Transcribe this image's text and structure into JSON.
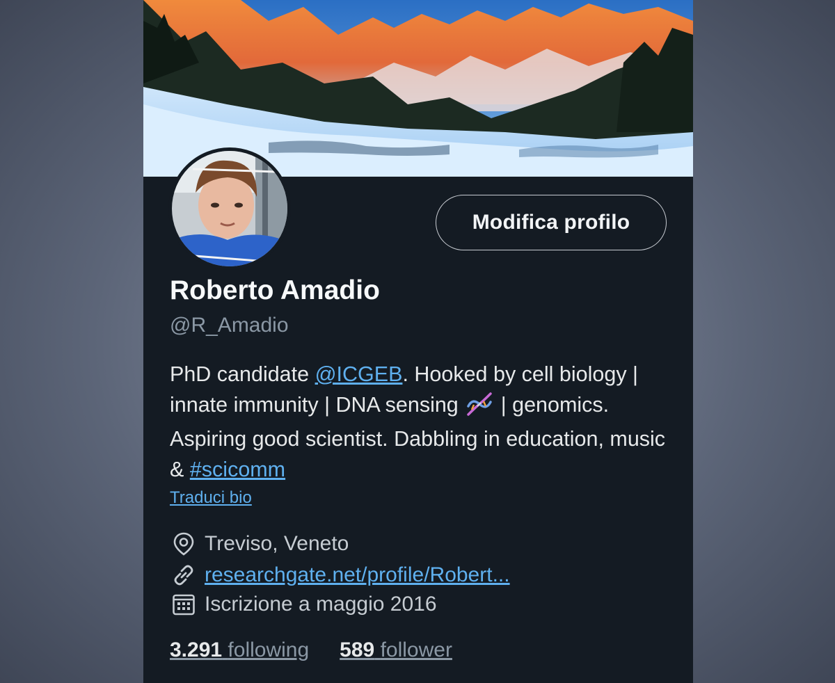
{
  "profile": {
    "display_name": "Roberto Amadio",
    "handle": "@R_Amadio",
    "edit_button_label": "Modifica profilo",
    "bio": {
      "part1": "PhD candidate ",
      "mention": "@ICGEB",
      "part2": ". Hooked by cell biology | innate immunity | DNA sensing ",
      "part3": " | genomics. Aspiring good scientist. Dabbling in education, music & ",
      "hashtag": "#scicomm"
    },
    "translate_bio_label": "Traduci bio",
    "location": "Treviso, Veneto",
    "website": "researchgate.net/profile/Robert...",
    "joined": "Iscrizione a maggio 2016",
    "following_count": "3.291",
    "following_label": "following",
    "followers_count": "589",
    "followers_label": "follower"
  },
  "icons": {
    "location": "map-pin-icon",
    "website": "link-icon",
    "joined": "calendar-icon",
    "bio_emoji": "dna-emoji-icon"
  },
  "colors": {
    "background": "#141b23",
    "link": "#5fb0ef",
    "secondary_text": "#8b98a5",
    "primary_text": "#e7e9ea"
  }
}
